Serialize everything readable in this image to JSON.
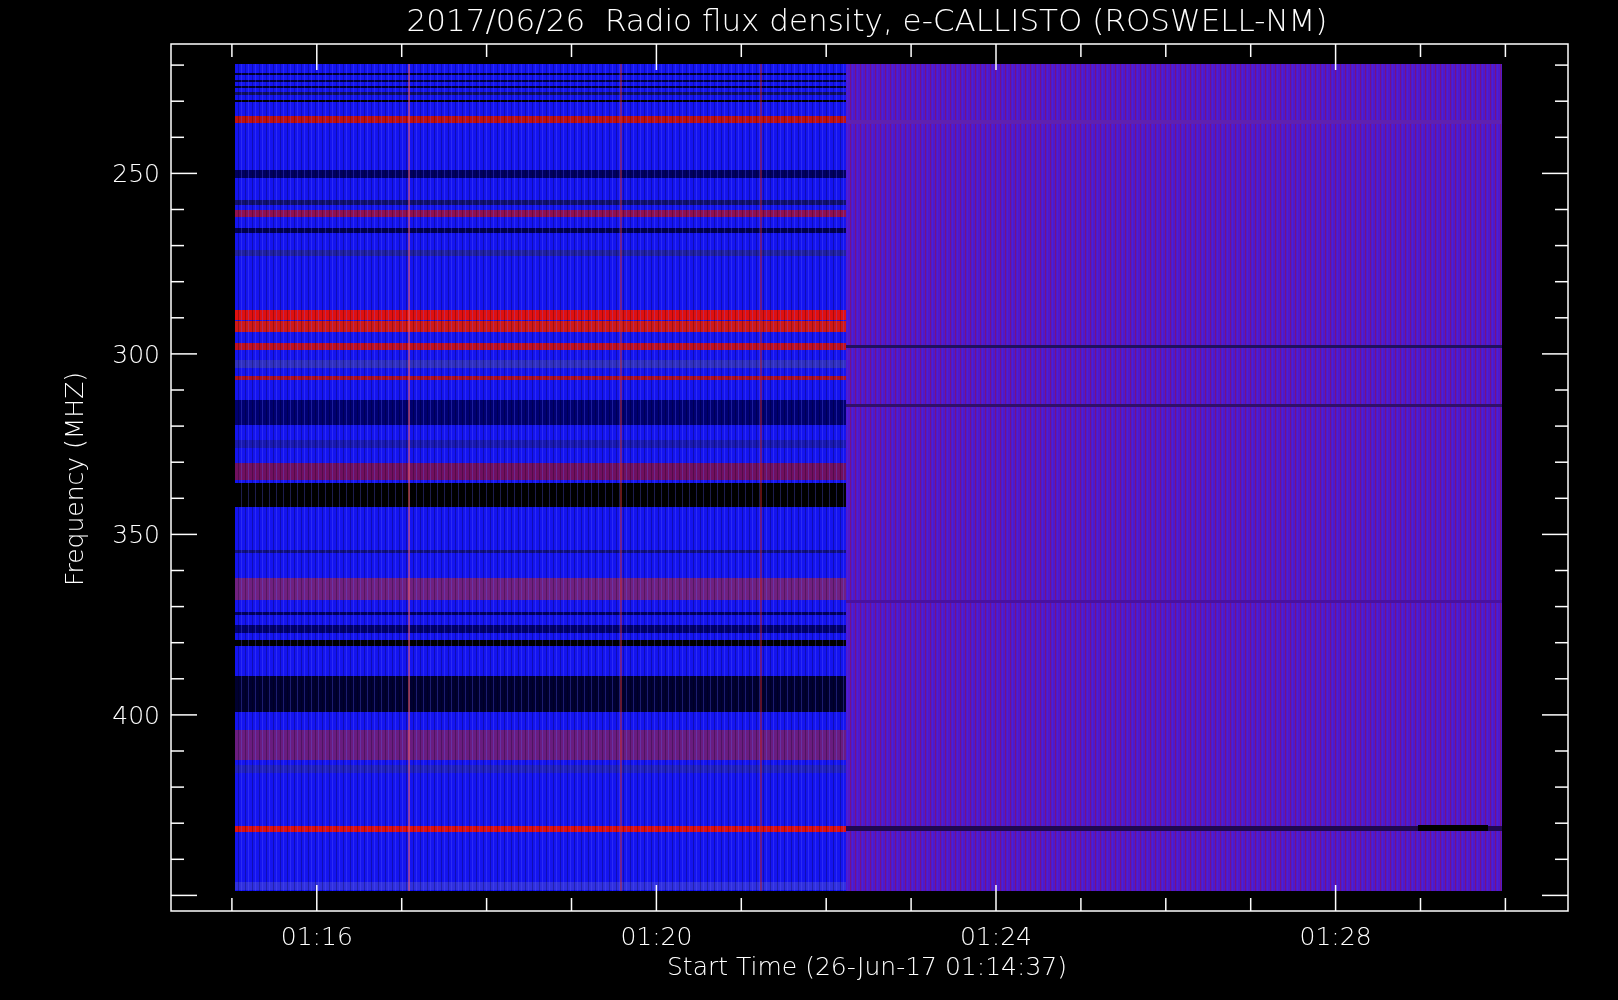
{
  "title": "2017/06/26  Radio flux density, e-CALLISTO (ROSWELL-NM)",
  "x_axis": {
    "label": "Start Time (26-Jun-17 01:14:37)",
    "ticks": [
      "01:16",
      "01:20",
      "01:24",
      "01:28"
    ]
  },
  "y_axis": {
    "label": "Frequency (MHZ)",
    "ticks": [
      "250",
      "300",
      "350",
      "400"
    ]
  }
}
